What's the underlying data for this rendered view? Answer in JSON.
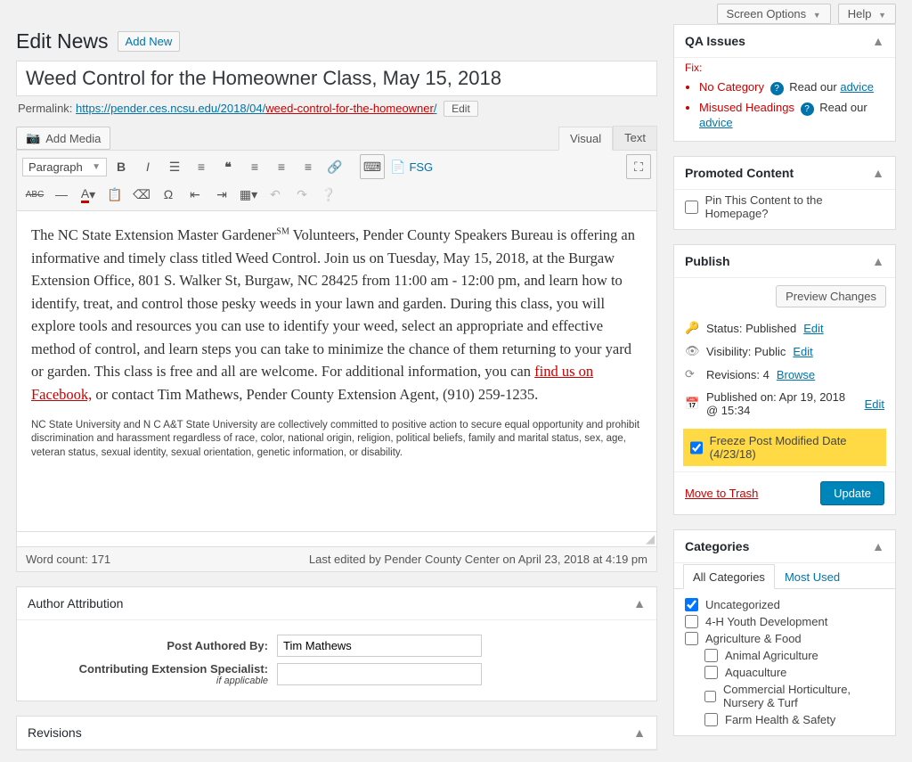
{
  "topbar": {
    "screen_options": "Screen Options",
    "help": "Help"
  },
  "page": {
    "heading": "Edit News",
    "add_new": "Add New"
  },
  "post": {
    "title": "Weed Control for the Homeowner Class, May 15, 2018",
    "permalink_label": "Permalink:",
    "permalink_base": "https://pender.ces.ncsu.edu/2018/04/",
    "permalink_slug": "weed-control-for-the-homeowner",
    "permalink_tail": "/",
    "edit_label": "Edit"
  },
  "media_button": "Add Media",
  "editor_tabs": {
    "visual": "Visual",
    "text": "Text"
  },
  "toolbar": {
    "format": "Paragraph",
    "fsg": "FSG"
  },
  "content": {
    "p1a": "The NC State Extension Master Gardener",
    "sm": "SM",
    "p1b": " Volunteers, Pender County Speakers Bureau is offering an informative and timely class titled Weed Control. Join us on Tuesday, May 15, 2018, at the Burgaw Extension Office, 801 S. Walker St, Burgaw, NC 28425 from 11:00 am - 12:00 pm, and learn how to identify, treat, and control those pesky weeds in your lawn and garden. During this class, you will explore tools and resources you can use to identify your weed, select an appropriate and effective method of control, and learn steps you can take to minimize the chance of them returning to your yard or garden. This class is free and all are welcome. For additional information, you can ",
    "link": "find us on Facebook,",
    "p1c": " or contact Tim Mathews, Pender County Extension Agent, (910) 259-1235.",
    "disclaimer": "NC State University and N C A&T State University are collectively committed to positive action to secure equal opportunity and prohibit discrimination and harassment regardless of race, color, national origin, religion, political beliefs, family and marital status, sex, age, veteran status, sexual identity, sexual orientation, genetic information, or disability."
  },
  "status_bar": {
    "word_count": "Word count: 171",
    "last_edited": "Last edited by Pender County Center on April 23, 2018 at 4:19 pm"
  },
  "author_box": {
    "title": "Author Attribution",
    "authored_label": "Post Authored By:",
    "authored_value": "Tim Mathews",
    "specialist_label": "Contributing Extension Specialist:",
    "specialist_sub": "if applicable",
    "specialist_value": ""
  },
  "revisions_box": {
    "title": "Revisions"
  },
  "qa": {
    "title": "QA Issues",
    "fix": "Fix:",
    "issue1": "No Category",
    "issue2": "Misused Headings",
    "read_our": "Read our",
    "advice": "advice"
  },
  "promoted": {
    "title": "Promoted Content",
    "pin_label": "Pin This Content to the Homepage?"
  },
  "publish": {
    "title": "Publish",
    "preview": "Preview Changes",
    "status_label": "Status: Published",
    "visibility_label": "Visibility: Public",
    "revisions_label": "Revisions: 4",
    "browse": "Browse",
    "published_on": "Published on: Apr 19, 2018 @ 15:34",
    "edit": "Edit",
    "freeze": "Freeze Post Modified Date (4/23/18)",
    "trash": "Move to Trash",
    "update": "Update"
  },
  "categories": {
    "title": "Categories",
    "tab_all": "All Categories",
    "tab_most": "Most Used",
    "items": [
      "Uncategorized",
      "4-H Youth Development",
      "Agriculture & Food",
      "Animal Agriculture",
      "Aquaculture",
      "Commercial Horticulture, Nursery & Turf",
      "Farm Health & Safety"
    ]
  }
}
